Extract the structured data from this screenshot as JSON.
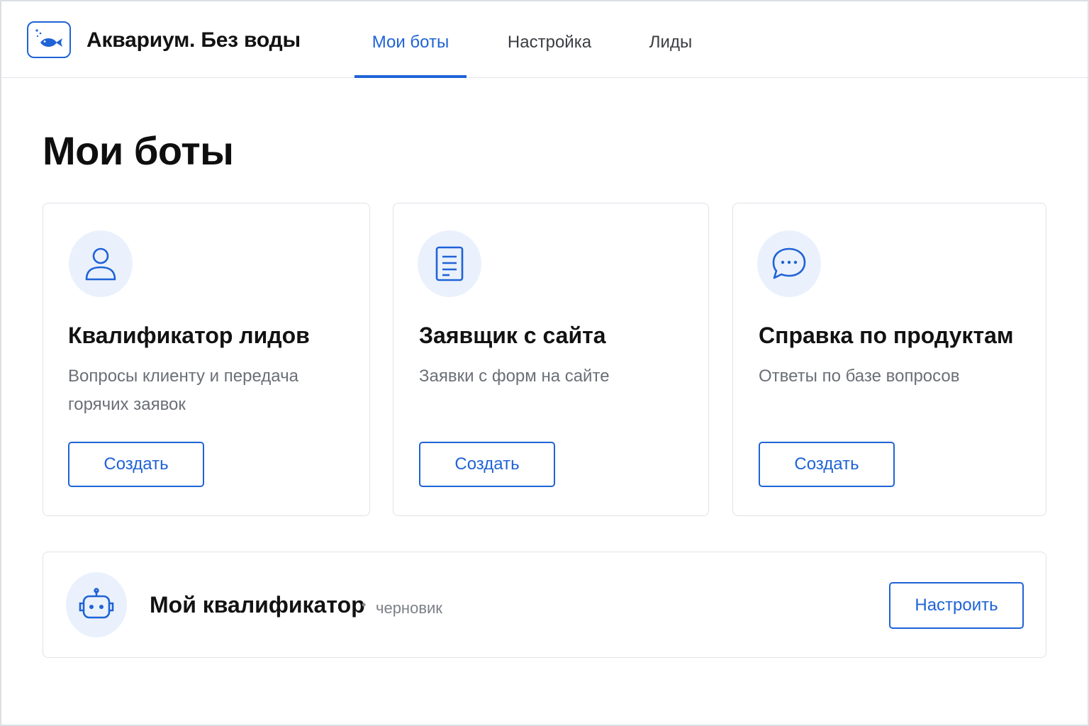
{
  "header": {
    "brand": "Аквариум. Без воды",
    "logo_icon": "fish-icon",
    "tabs": [
      {
        "label": "Мои боты",
        "active": true
      },
      {
        "label": "Настройка",
        "active": false
      },
      {
        "label": "Лиды",
        "active": false
      }
    ]
  },
  "page": {
    "title": "Мои боты"
  },
  "cards": [
    {
      "icon": "user-icon",
      "title": "Квалификатор лидов",
      "description": "Вопросы клиенту и передача горячих заявок",
      "button": "Создать"
    },
    {
      "icon": "document-icon",
      "title": "Заявщик с сайта",
      "description": "Заявки с форм на сайте",
      "button": "Создать"
    },
    {
      "icon": "chat-bubble-icon",
      "title": "Справка по продуктам",
      "description": "Ответы по базе вопросов",
      "button": "Создать"
    }
  ],
  "draft": {
    "icon": "robot-icon",
    "name": "Мой квалификатор",
    "separator": "•",
    "status": "черновик",
    "button": "Настроить"
  },
  "colors": {
    "accent": "#1f63d6",
    "icon_bg": "#eaf1fc",
    "text_primary": "#121212",
    "text_secondary": "#6b6f76",
    "border": "#dfe2e7"
  }
}
